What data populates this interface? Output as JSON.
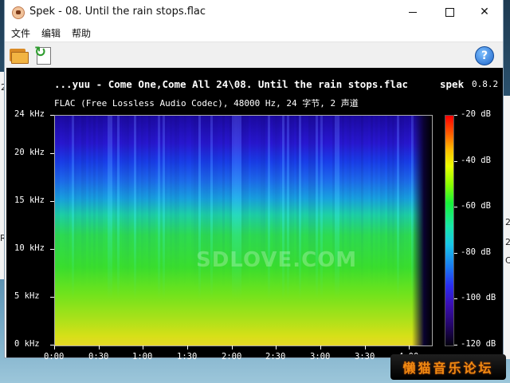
{
  "window": {
    "title": "Spek - 08. Until the rain stops.flac",
    "controls": {
      "minimize_icon": "minimize-icon",
      "maximize_icon": "maximize-icon",
      "close_glyph": "✕"
    }
  },
  "menu": {
    "items": [
      {
        "label": "文件"
      },
      {
        "label": "编辑"
      },
      {
        "label": "帮助"
      }
    ]
  },
  "toolbar": {
    "open_icon": "folder-open-icon",
    "save_icon": "save-arrow-icon",
    "help_label": "?"
  },
  "spek": {
    "file_line": "...yuu - Come One,Come All 24\\08. Until the rain stops.flac",
    "app_name": "spek",
    "version": "0.8.2",
    "format_line": "FLAC (Free Lossless Audio Codec), 48000 Hz, 24 字节, 2 声道",
    "watermark": "SDLOVE.COM"
  },
  "chart_data": {
    "type": "heatmap",
    "title": "",
    "x_axis": {
      "label": "",
      "unit": "time (m:ss)",
      "range": [
        0,
        255
      ],
      "ticks": [
        "0:00",
        "0:30",
        "1:00",
        "1:30",
        "2:00",
        "2:30",
        "3:00",
        "3:30",
        "4:00"
      ],
      "tick_values_seconds": [
        0,
        30,
        60,
        90,
        120,
        150,
        180,
        210,
        240
      ]
    },
    "y_axis": {
      "label": "",
      "unit": "kHz",
      "range": [
        0,
        24
      ],
      "ticks": [
        "0 kHz",
        "5 kHz",
        "10 kHz",
        "15 kHz",
        "20 kHz",
        "24 kHz"
      ],
      "tick_values": [
        0,
        5,
        10,
        15,
        20,
        24
      ]
    },
    "colorbar": {
      "unit": "dB",
      "range": [
        -120,
        -20
      ],
      "ticks": [
        "-20 dB",
        "-40 dB",
        "-60 dB",
        "-80 dB",
        "-100 dB",
        "-120 dB"
      ],
      "tick_values": [
        -20,
        -40,
        -60,
        -80,
        -100,
        -120
      ]
    },
    "grid": false
  },
  "overlay": {
    "forum_badge": "懒猫音乐论坛"
  },
  "background": {
    "fragments": [
      "2",
      "R",
      "C",
      "2",
      "2"
    ]
  }
}
